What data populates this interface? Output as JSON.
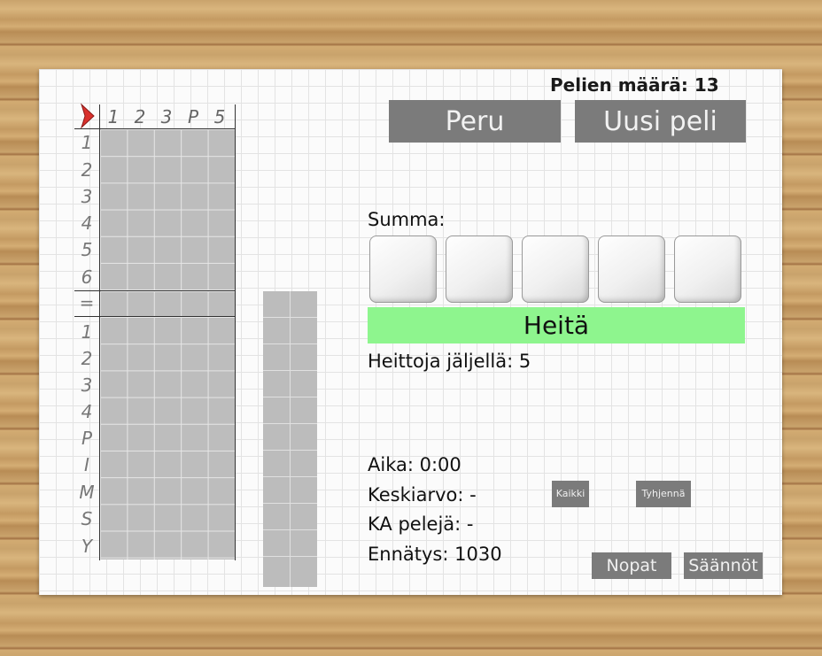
{
  "games_played": "Pelien määrä: 13",
  "buttons": {
    "undo": "Peru",
    "new_game": "Uusi peli",
    "roll": "Heitä",
    "all": "Kaikki",
    "clear": "Tyhjennä",
    "dice": "Nopat",
    "rules": "Säännöt"
  },
  "sum_label": "Summa:",
  "rolls_left": "Heittoja jäljellä: 5",
  "stats": {
    "time": "Aika: 0:00",
    "average": "Keskiarvo: -",
    "avg_games": "KA pelejä: -",
    "record": "Ennätys: 1030"
  },
  "sheet": {
    "column_headers": [
      "1",
      "2",
      "3",
      "P",
      "5"
    ],
    "upper_rows": [
      "1",
      "2",
      "3",
      "4",
      "5",
      "6"
    ],
    "subtotal_row": "=",
    "lower_rows": [
      "1",
      "2",
      "3",
      "4",
      "P",
      "I",
      "M",
      "S",
      "Y"
    ]
  },
  "colors": {
    "roll_button": "#8ef58e",
    "button_gray": "#7b7b7b",
    "cell_gray": "#bdbdbd",
    "marker_red": "#d9302c"
  },
  "icons": {
    "turn_marker": "red-arrow-icon"
  }
}
